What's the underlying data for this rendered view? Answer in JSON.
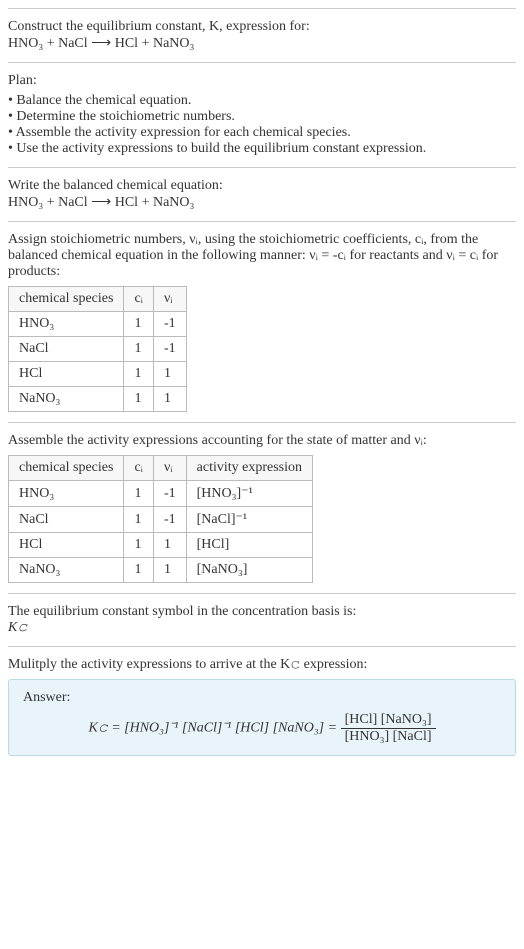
{
  "header": {
    "prompt_line1": "Construct the equilibrium constant, K, expression for:",
    "equation": "HNO₃ + NaCl ⟶ HCl + NaNO₃"
  },
  "plan": {
    "title": "Plan:",
    "items": [
      "Balance the chemical equation.",
      "Determine the stoichiometric numbers.",
      "Assemble the activity expression for each chemical species.",
      "Use the activity expressions to build the equilibrium constant expression."
    ]
  },
  "balanced": {
    "intro": "Write the balanced chemical equation:",
    "equation": "HNO₃ + NaCl ⟶ HCl + NaNO₃"
  },
  "stoich": {
    "intro": "Assign stoichiometric numbers, νᵢ, using the stoichiometric coefficients, cᵢ, from the balanced chemical equation in the following manner: νᵢ = -cᵢ for reactants and νᵢ = cᵢ for products:",
    "headers": [
      "chemical species",
      "cᵢ",
      "νᵢ"
    ],
    "rows": [
      [
        "HNO₃",
        "1",
        "-1"
      ],
      [
        "NaCl",
        "1",
        "-1"
      ],
      [
        "HCl",
        "1",
        "1"
      ],
      [
        "NaNO₃",
        "1",
        "1"
      ]
    ]
  },
  "activity": {
    "intro": "Assemble the activity expressions accounting for the state of matter and νᵢ:",
    "headers": [
      "chemical species",
      "cᵢ",
      "νᵢ",
      "activity expression"
    ],
    "rows": [
      [
        "HNO₃",
        "1",
        "-1",
        "[HNO₃]⁻¹"
      ],
      [
        "NaCl",
        "1",
        "-1",
        "[NaCl]⁻¹"
      ],
      [
        "HCl",
        "1",
        "1",
        "[HCl]"
      ],
      [
        "NaNO₃",
        "1",
        "1",
        "[NaNO₃]"
      ]
    ]
  },
  "symbol": {
    "line1": "The equilibrium constant symbol in the concentration basis is:",
    "line2": "K𝚌"
  },
  "multiply": {
    "intro": "Mulitply the activity expressions to arrive at the K𝚌 expression:"
  },
  "answer": {
    "label": "Answer:",
    "lhs": "K𝚌 = [HNO₃]⁻¹ [NaCl]⁻¹ [HCl] [NaNO₃] = ",
    "frac_num": "[HCl] [NaNO₃]",
    "frac_den": "[HNO₃] [NaCl]"
  }
}
